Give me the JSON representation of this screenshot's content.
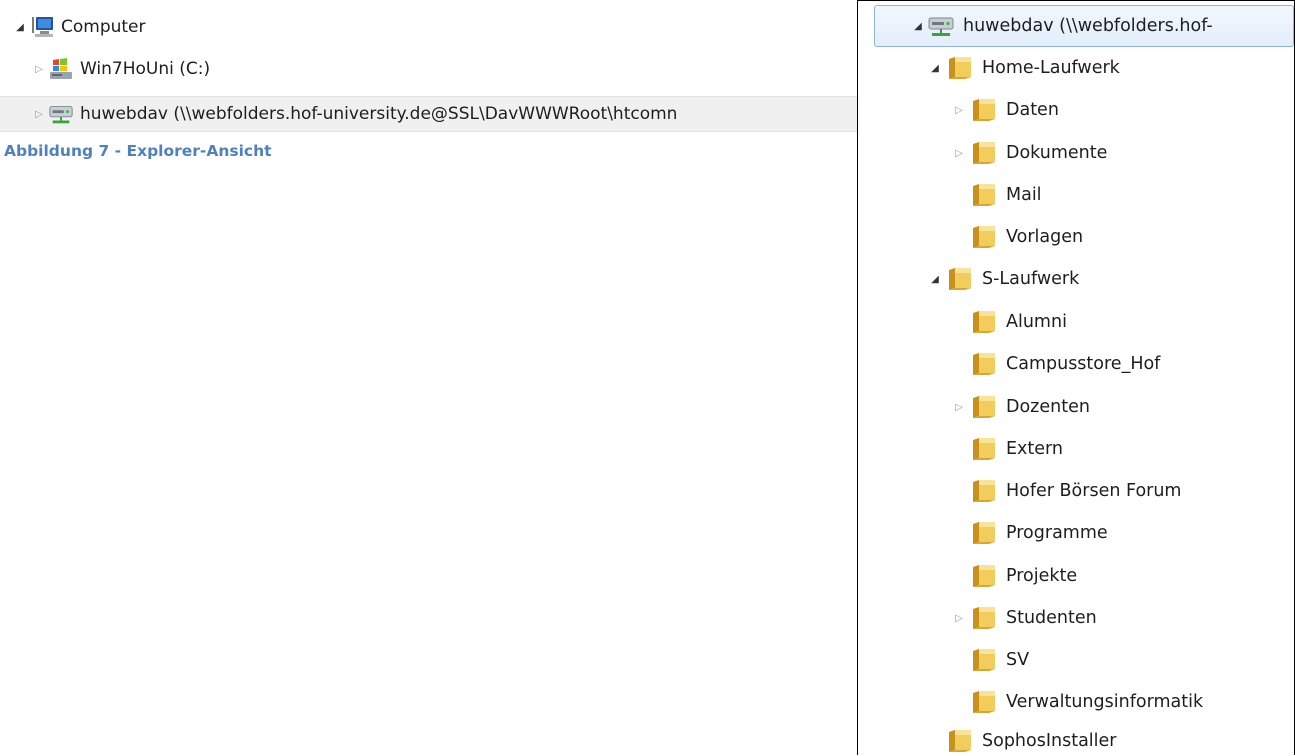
{
  "left_tree": {
    "items": [
      {
        "label": "Computer",
        "icon": "computer-icon",
        "expanded": true
      },
      {
        "label": "Win7HoUni (C:)",
        "icon": "windows-drive-icon",
        "expanded": false
      },
      {
        "label": "huwebdav (\\\\webfolders.hof-university.de@SSL\\DavWWWRoot\\htcomn",
        "icon": "network-drive-icon",
        "expanded": false
      }
    ]
  },
  "caption": "Abbildung 7 - Explorer-Ansicht",
  "right_tree": {
    "root": {
      "label": "huwebdav (\\\\webfolders.hof-",
      "icon": "network-drive-icon",
      "expanded": true,
      "selected": true
    },
    "home": {
      "label": "Home-Laufwerk",
      "expanded": true,
      "children": [
        {
          "label": "Daten",
          "has_children": true
        },
        {
          "label": "Dokumente",
          "has_children": true
        },
        {
          "label": "Mail",
          "has_children": false
        },
        {
          "label": "Vorlagen",
          "has_children": false
        }
      ]
    },
    "s": {
      "label": "S-Laufwerk",
      "expanded": true,
      "children": [
        {
          "label": "Alumni",
          "has_children": false
        },
        {
          "label": "Campusstore_Hof",
          "has_children": false
        },
        {
          "label": "Dozenten",
          "has_children": true
        },
        {
          "label": "Extern",
          "has_children": false
        },
        {
          "label": "Hofer Börsen Forum",
          "has_children": false
        },
        {
          "label": "Programme",
          "has_children": false
        },
        {
          "label": "Projekte",
          "has_children": false
        },
        {
          "label": "Studenten",
          "has_children": true
        },
        {
          "label": "SV",
          "has_children": false
        },
        {
          "label": "Verwaltungsinformatik",
          "has_children": false
        }
      ]
    },
    "sophos": {
      "label": "SophosInstaller",
      "expanded": false
    }
  },
  "colors": {
    "caption": "#4f81bd",
    "selection_border": "#8fb6e2",
    "folder": "#e8b93a"
  }
}
